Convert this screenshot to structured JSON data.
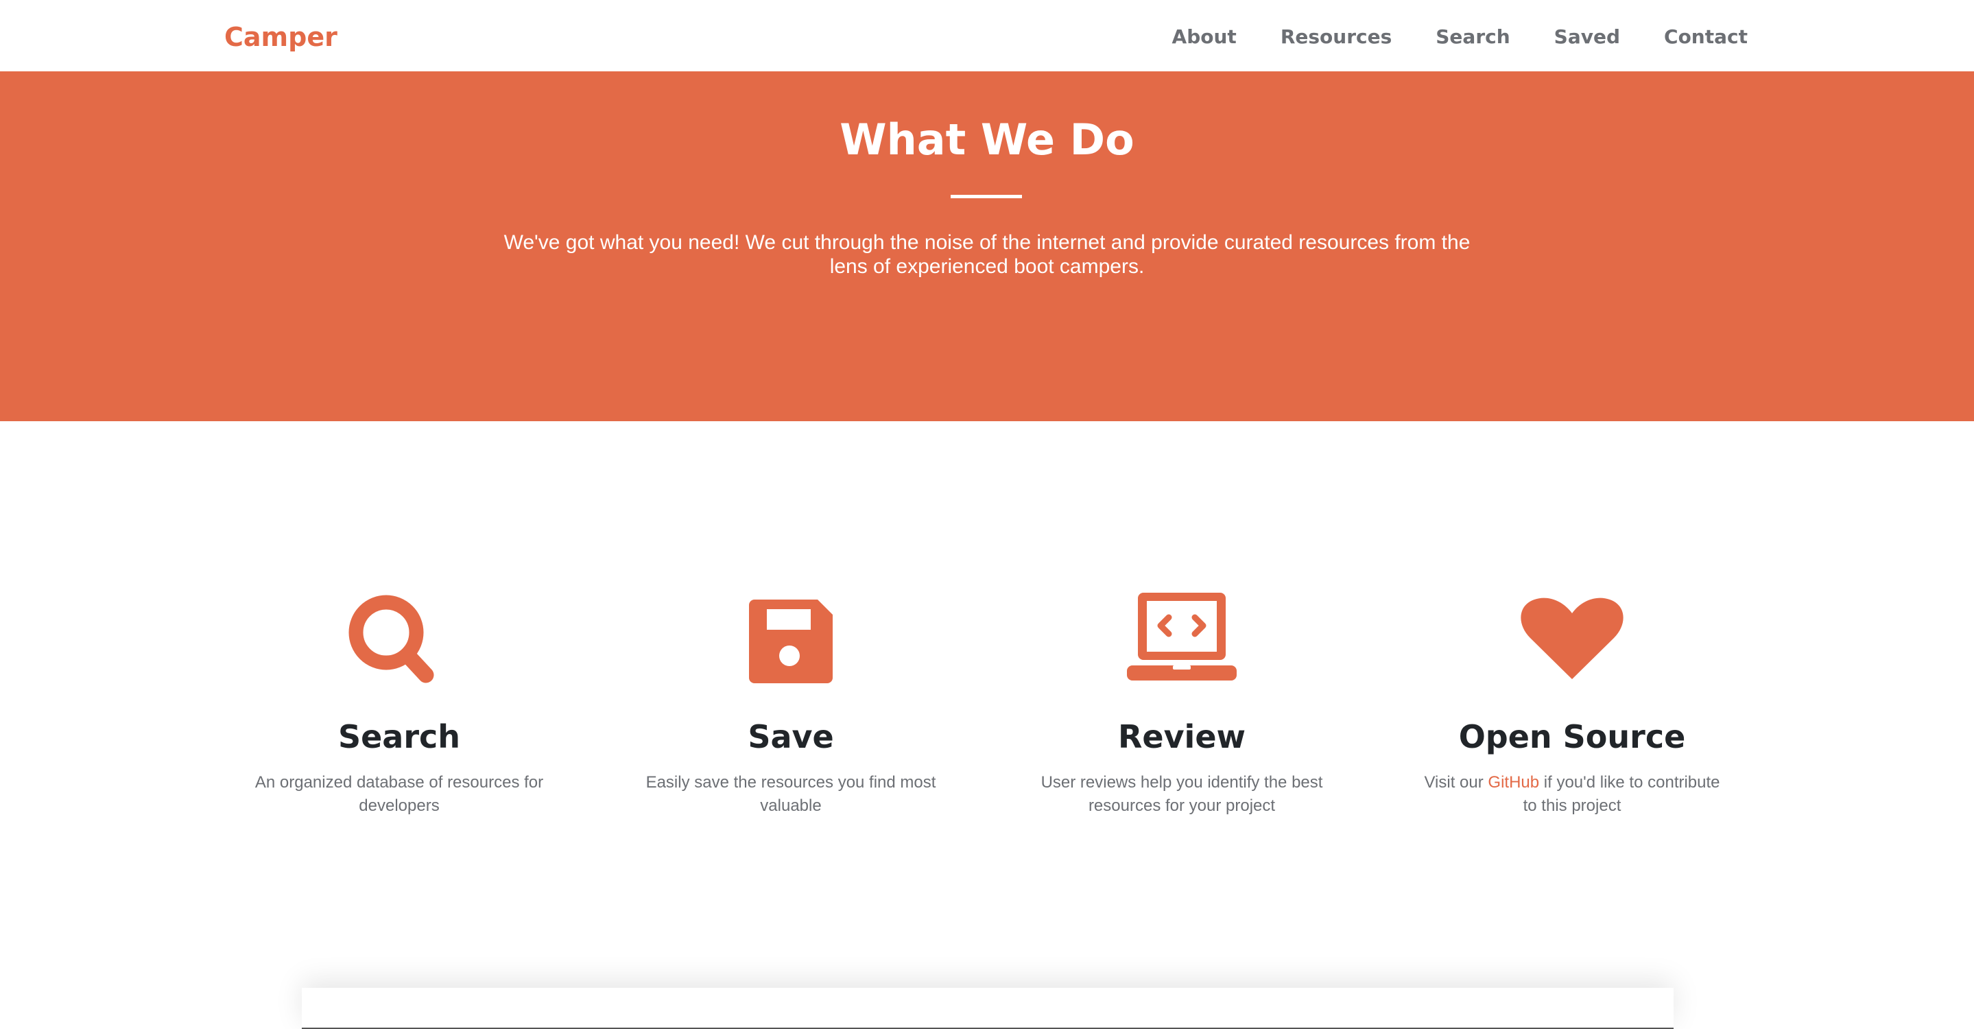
{
  "nav": {
    "brand": "Camper",
    "links": [
      "About",
      "Resources",
      "Search",
      "Saved",
      "Contact"
    ]
  },
  "hero": {
    "title": "What We Do",
    "text": "We've got what you need! We cut through the noise of the internet and provide curated resources from the lens of experienced boot campers."
  },
  "features": [
    {
      "icon": "search-icon",
      "title": "Search",
      "desc": "An organized database of resources for developers"
    },
    {
      "icon": "save-icon",
      "title": "Save",
      "desc": "Easily save the resources you find most valuable"
    },
    {
      "icon": "laptop-code-icon",
      "title": "Review",
      "desc": "User reviews help you identify the best resources for your project"
    },
    {
      "icon": "heart-icon",
      "title": "Open Source",
      "desc_before": "Visit our ",
      "link": "GitHub",
      "desc_after": " if you'd like to contribute to this project"
    }
  ],
  "colors": {
    "accent": "#e36a47",
    "heading": "#212529",
    "muted": "#6c6f74"
  }
}
